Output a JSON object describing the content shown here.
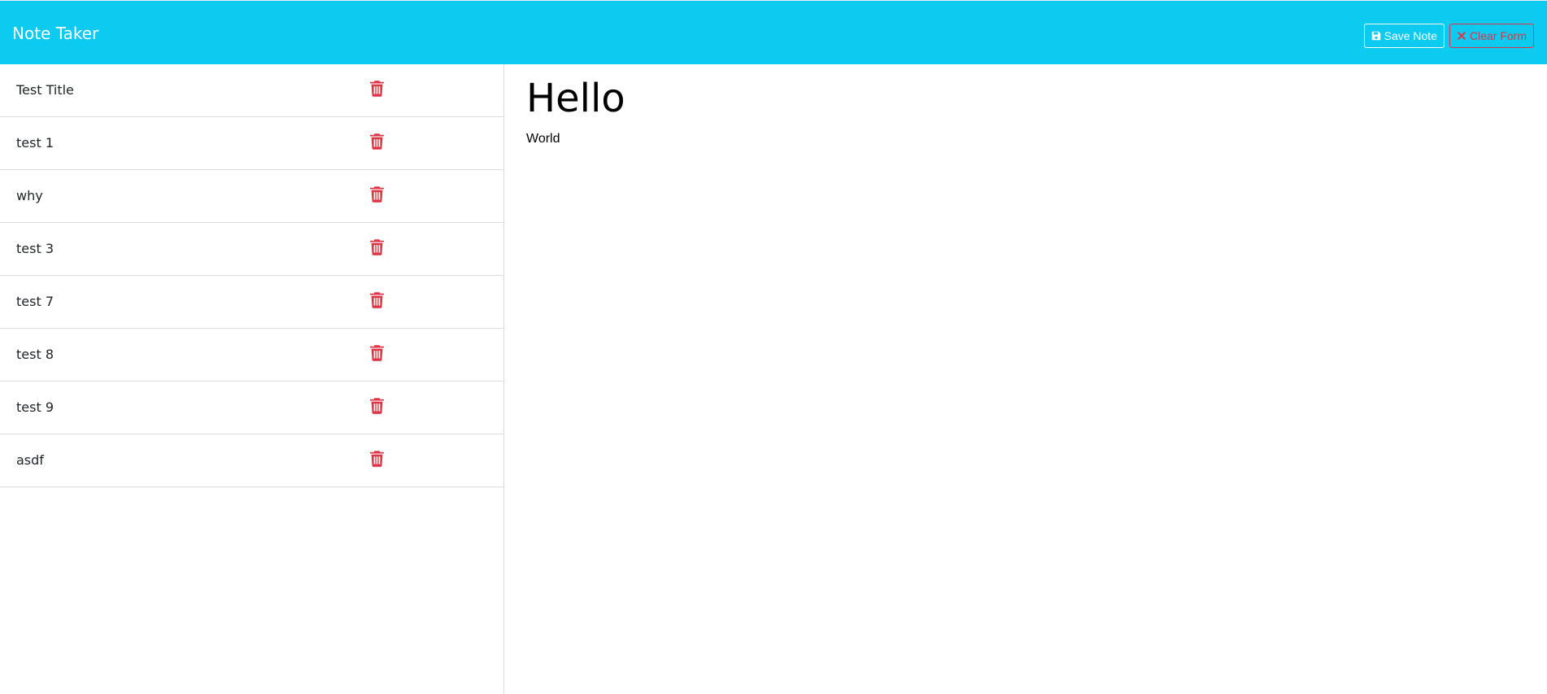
{
  "app": {
    "brand": "Note Taker"
  },
  "toolbar": {
    "save_label": "Save Note",
    "save_icon": "floppy-disk-icon",
    "clear_label": "Clear Form",
    "clear_icon": "x-icon"
  },
  "notes": [
    {
      "title": "Test Title",
      "delete_icon": "trash-icon"
    },
    {
      "title": "test 1",
      "delete_icon": "trash-icon"
    },
    {
      "title": "why",
      "delete_icon": "trash-icon"
    },
    {
      "title": "test 3",
      "delete_icon": "trash-icon"
    },
    {
      "title": "test 7",
      "delete_icon": "trash-icon"
    },
    {
      "title": "test 8",
      "delete_icon": "trash-icon"
    },
    {
      "title": "test 9",
      "delete_icon": "trash-icon"
    },
    {
      "title": "asdf",
      "delete_icon": "trash-icon"
    }
  ],
  "editor": {
    "title_value": "Hello",
    "text_value": "World"
  },
  "colors": {
    "navbar": "#0dcaf0",
    "danger": "#dc3545",
    "border": "#dcdcdc"
  }
}
